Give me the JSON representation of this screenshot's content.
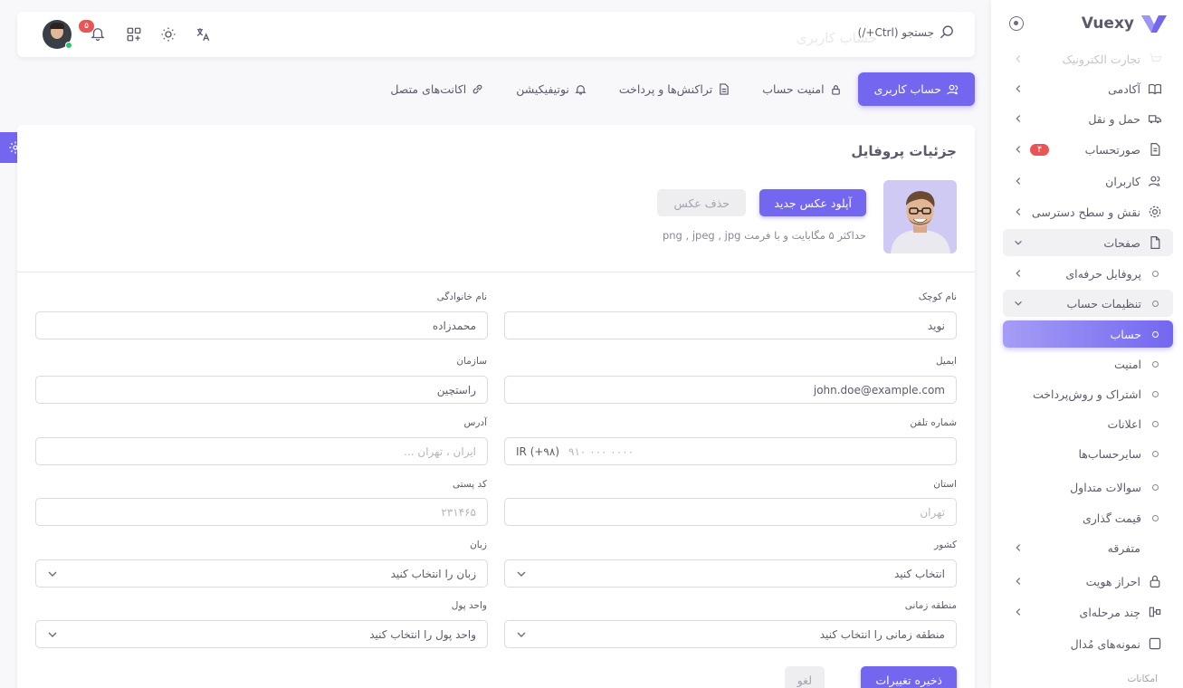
{
  "brand": {
    "name": "Vuexy"
  },
  "sidebar": {
    "items": [
      {
        "label": "تجارت الکترونیک",
        "has_children": true
      },
      {
        "label": "آکادمی",
        "has_children": true
      },
      {
        "label": "حمل و نقل",
        "has_children": true
      },
      {
        "label": "صورتحساب",
        "badge": "۴",
        "has_children": true
      },
      {
        "label": "کاربران",
        "has_children": true
      },
      {
        "label": "نقش و سطح دسترسی",
        "has_children": true
      },
      {
        "label": "صفحات",
        "has_children": true,
        "open": true
      },
      {
        "label": "پروفایل حرفه‌ای",
        "has_children": true
      },
      {
        "label": "تنظیمات حساب",
        "has_children": true,
        "open": true
      },
      {
        "label": "حساب",
        "active": true
      },
      {
        "label": "امنیت"
      },
      {
        "label": "اشتراک و روش‌پرداخت"
      },
      {
        "label": "اعلانات"
      },
      {
        "label": "سایرحساب‌ها"
      },
      {
        "label": "سوالات متداول"
      },
      {
        "label": "قیمت گذاری"
      },
      {
        "label": "متفرقه",
        "has_children": true
      },
      {
        "label": "احراز هویت",
        "has_children": true
      },
      {
        "label": "چند مرحله‌ای",
        "has_children": true
      },
      {
        "label": "نمونه‌های مُدال"
      }
    ],
    "section_label": "امکانات"
  },
  "navbar": {
    "search_text": "جستجو (Ctrl+/)",
    "ghost_title": "حساب کاربری",
    "notification_count": "۵"
  },
  "tabs": [
    {
      "label": "حساب کاربری",
      "active": true
    },
    {
      "label": "امنیت حساب"
    },
    {
      "label": "تراکنش‌ها و پرداخت"
    },
    {
      "label": "نوتیفیکیشن"
    },
    {
      "label": "اکانت‌های متصل"
    }
  ],
  "profile": {
    "title": "جزئیات پروفایل",
    "upload_label": "آپلود عکس جدید",
    "delete_label": "حذف عکس",
    "hint": "حداکثر ۵ مگابایت و با فرمت png , jpeg , jpg"
  },
  "form": {
    "first_name": {
      "label": "نام کوچک",
      "value": "نوید"
    },
    "last_name": {
      "label": "نام خانوادگی",
      "value": "محمدزاده"
    },
    "email": {
      "label": "ایمیل",
      "value": "john.doe@example.com"
    },
    "organization": {
      "label": "سازمان",
      "value": "راستچین"
    },
    "phone": {
      "label": "شماره تلفن",
      "prefix": "IR (+۹۸)",
      "placeholder": "۹۱۰ ۰۰۰ ۰۰۰۰"
    },
    "address": {
      "label": "آدرس",
      "placeholder": "ایران ، تهران ..."
    },
    "state": {
      "label": "استان",
      "placeholder": "تهران"
    },
    "zip": {
      "label": "کد پستی",
      "placeholder": "۲۳۱۴۶۵"
    },
    "country": {
      "label": "کشور",
      "value": "انتخاب کنید"
    },
    "language": {
      "label": "زبان",
      "value": "زبان را انتخاب کنید"
    },
    "timezone": {
      "label": "منطقه زمانی",
      "value": "منطقه زمانی را انتخاب کنید"
    },
    "currency": {
      "label": "واحد پول",
      "value": "واحد پول را انتخاب کنید"
    },
    "save_label": "ذخیره تغییرات",
    "cancel_label": "لغو"
  },
  "colors": {
    "primary": "#7367f0",
    "danger": "#ea5455",
    "success": "#28c76f"
  }
}
